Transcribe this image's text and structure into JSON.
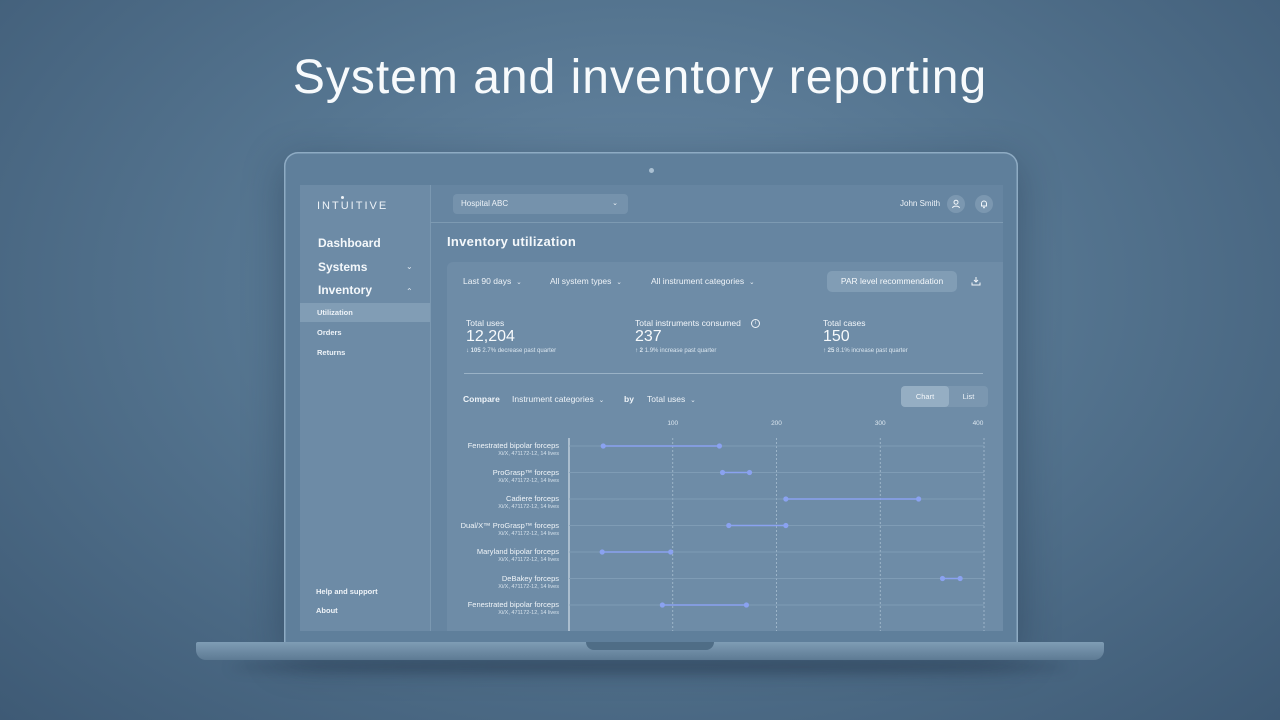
{
  "headline": "System and inventory reporting",
  "app": {
    "logo": "INTUITIVE",
    "hospital_select": "Hospital ABC",
    "user_name": "John Smith"
  },
  "sidebar": {
    "dashboard": "Dashboard",
    "systems": "Systems",
    "inventory": "Inventory",
    "sub_items": [
      "Utilization",
      "Orders",
      "Returns"
    ],
    "help": "Help and support",
    "about": "About"
  },
  "page": {
    "title": "Inventory utilization",
    "filters": [
      "Last 90 days",
      "All system types",
      "All instrument categories"
    ],
    "par_button": "PAR level recommendation"
  },
  "stats": [
    {
      "label": "Total uses",
      "value": "12,204",
      "change_arrow": "↓",
      "change_value": "105",
      "change_text": "2.7% decrease past quarter"
    },
    {
      "label": "Total instruments consumed",
      "value": "237",
      "change_arrow": "↑",
      "change_value": "2",
      "change_text": "1.9% increase past quarter"
    },
    {
      "label": "Total cases",
      "value": "150",
      "change_arrow": "↑",
      "change_value": "25",
      "change_text": "8.1% increase past quarter"
    }
  ],
  "compare": {
    "label": "Compare",
    "dimension": "Instrument categories",
    "by": "by",
    "metric": "Total uses",
    "view_chart": "Chart",
    "view_list": "List"
  },
  "colors": {
    "accent": "#8aa2f0",
    "background": "#557590"
  },
  "chart_data": {
    "type": "dumbbell",
    "x_ticks": [
      100,
      200,
      300,
      400
    ],
    "xlim": [
      0,
      400
    ],
    "rows": [
      {
        "name": "Fenestrated bipolar forceps",
        "sub": "Xi/X, 471172-12, 14 lives",
        "start": 33,
        "end": 145
      },
      {
        "name": "ProGrasp™ forceps",
        "sub": "Xi/X, 471172-12, 14 lives",
        "start": 148,
        "end": 174
      },
      {
        "name": "Cadiere forceps",
        "sub": "Xi/X, 471172-12, 14 lives",
        "start": 209,
        "end": 337
      },
      {
        "name": "Dual/X™ ProGrasp™ forceps",
        "sub": "Xi/X, 471172-12, 14 lives",
        "start": 154,
        "end": 209
      },
      {
        "name": "Maryland bipolar forceps",
        "sub": "Xi/X, 471172-12, 14 lives",
        "start": 32,
        "end": 98
      },
      {
        "name": "DeBakey forceps",
        "sub": "Xi/X, 471172-12, 14 lives",
        "start": 360,
        "end": 377
      },
      {
        "name": "Fenestrated bipolar forceps",
        "sub": "Xi/X, 471172-12, 14 lives",
        "start": 90,
        "end": 171
      }
    ]
  }
}
